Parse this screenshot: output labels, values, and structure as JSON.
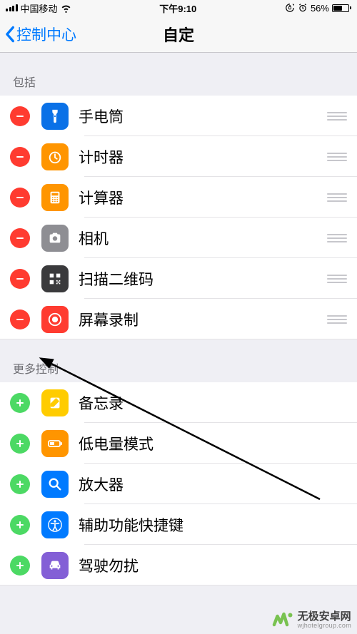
{
  "status": {
    "carrier": "中国移动",
    "time": "下午9:10",
    "battery_pct": "56%"
  },
  "nav": {
    "back_label": "控制中心",
    "title": "自定"
  },
  "sections": {
    "included_header": "包括",
    "more_header": "更多控制"
  },
  "included": [
    {
      "label": "手电筒",
      "icon": "flashlight",
      "bg": "bg-blue"
    },
    {
      "label": "计时器",
      "icon": "timer",
      "bg": "bg-orange"
    },
    {
      "label": "计算器",
      "icon": "calculator",
      "bg": "bg-orange"
    },
    {
      "label": "相机",
      "icon": "camera",
      "bg": "bg-gray"
    },
    {
      "label": "扫描二维码",
      "icon": "qr",
      "bg": "bg-dark"
    },
    {
      "label": "屏幕录制",
      "icon": "record",
      "bg": "bg-red"
    }
  ],
  "more": [
    {
      "label": "备忘录",
      "icon": "notes",
      "bg": "bg-yellow"
    },
    {
      "label": "低电量模式",
      "icon": "lowpower",
      "bg": "bg-orange"
    },
    {
      "label": "放大器",
      "icon": "magnifier",
      "bg": "bg-blue2"
    },
    {
      "label": "辅助功能快捷键",
      "icon": "accessibility",
      "bg": "bg-blue2"
    },
    {
      "label": "驾驶勿扰",
      "icon": "car",
      "bg": "bg-purple"
    }
  ],
  "watermark": {
    "cn": "无极安卓网",
    "en": "wjhotelgroup.com"
  },
  "colors": {
    "accent": "#007aff",
    "remove": "#ff3b30",
    "add": "#4cd964"
  }
}
